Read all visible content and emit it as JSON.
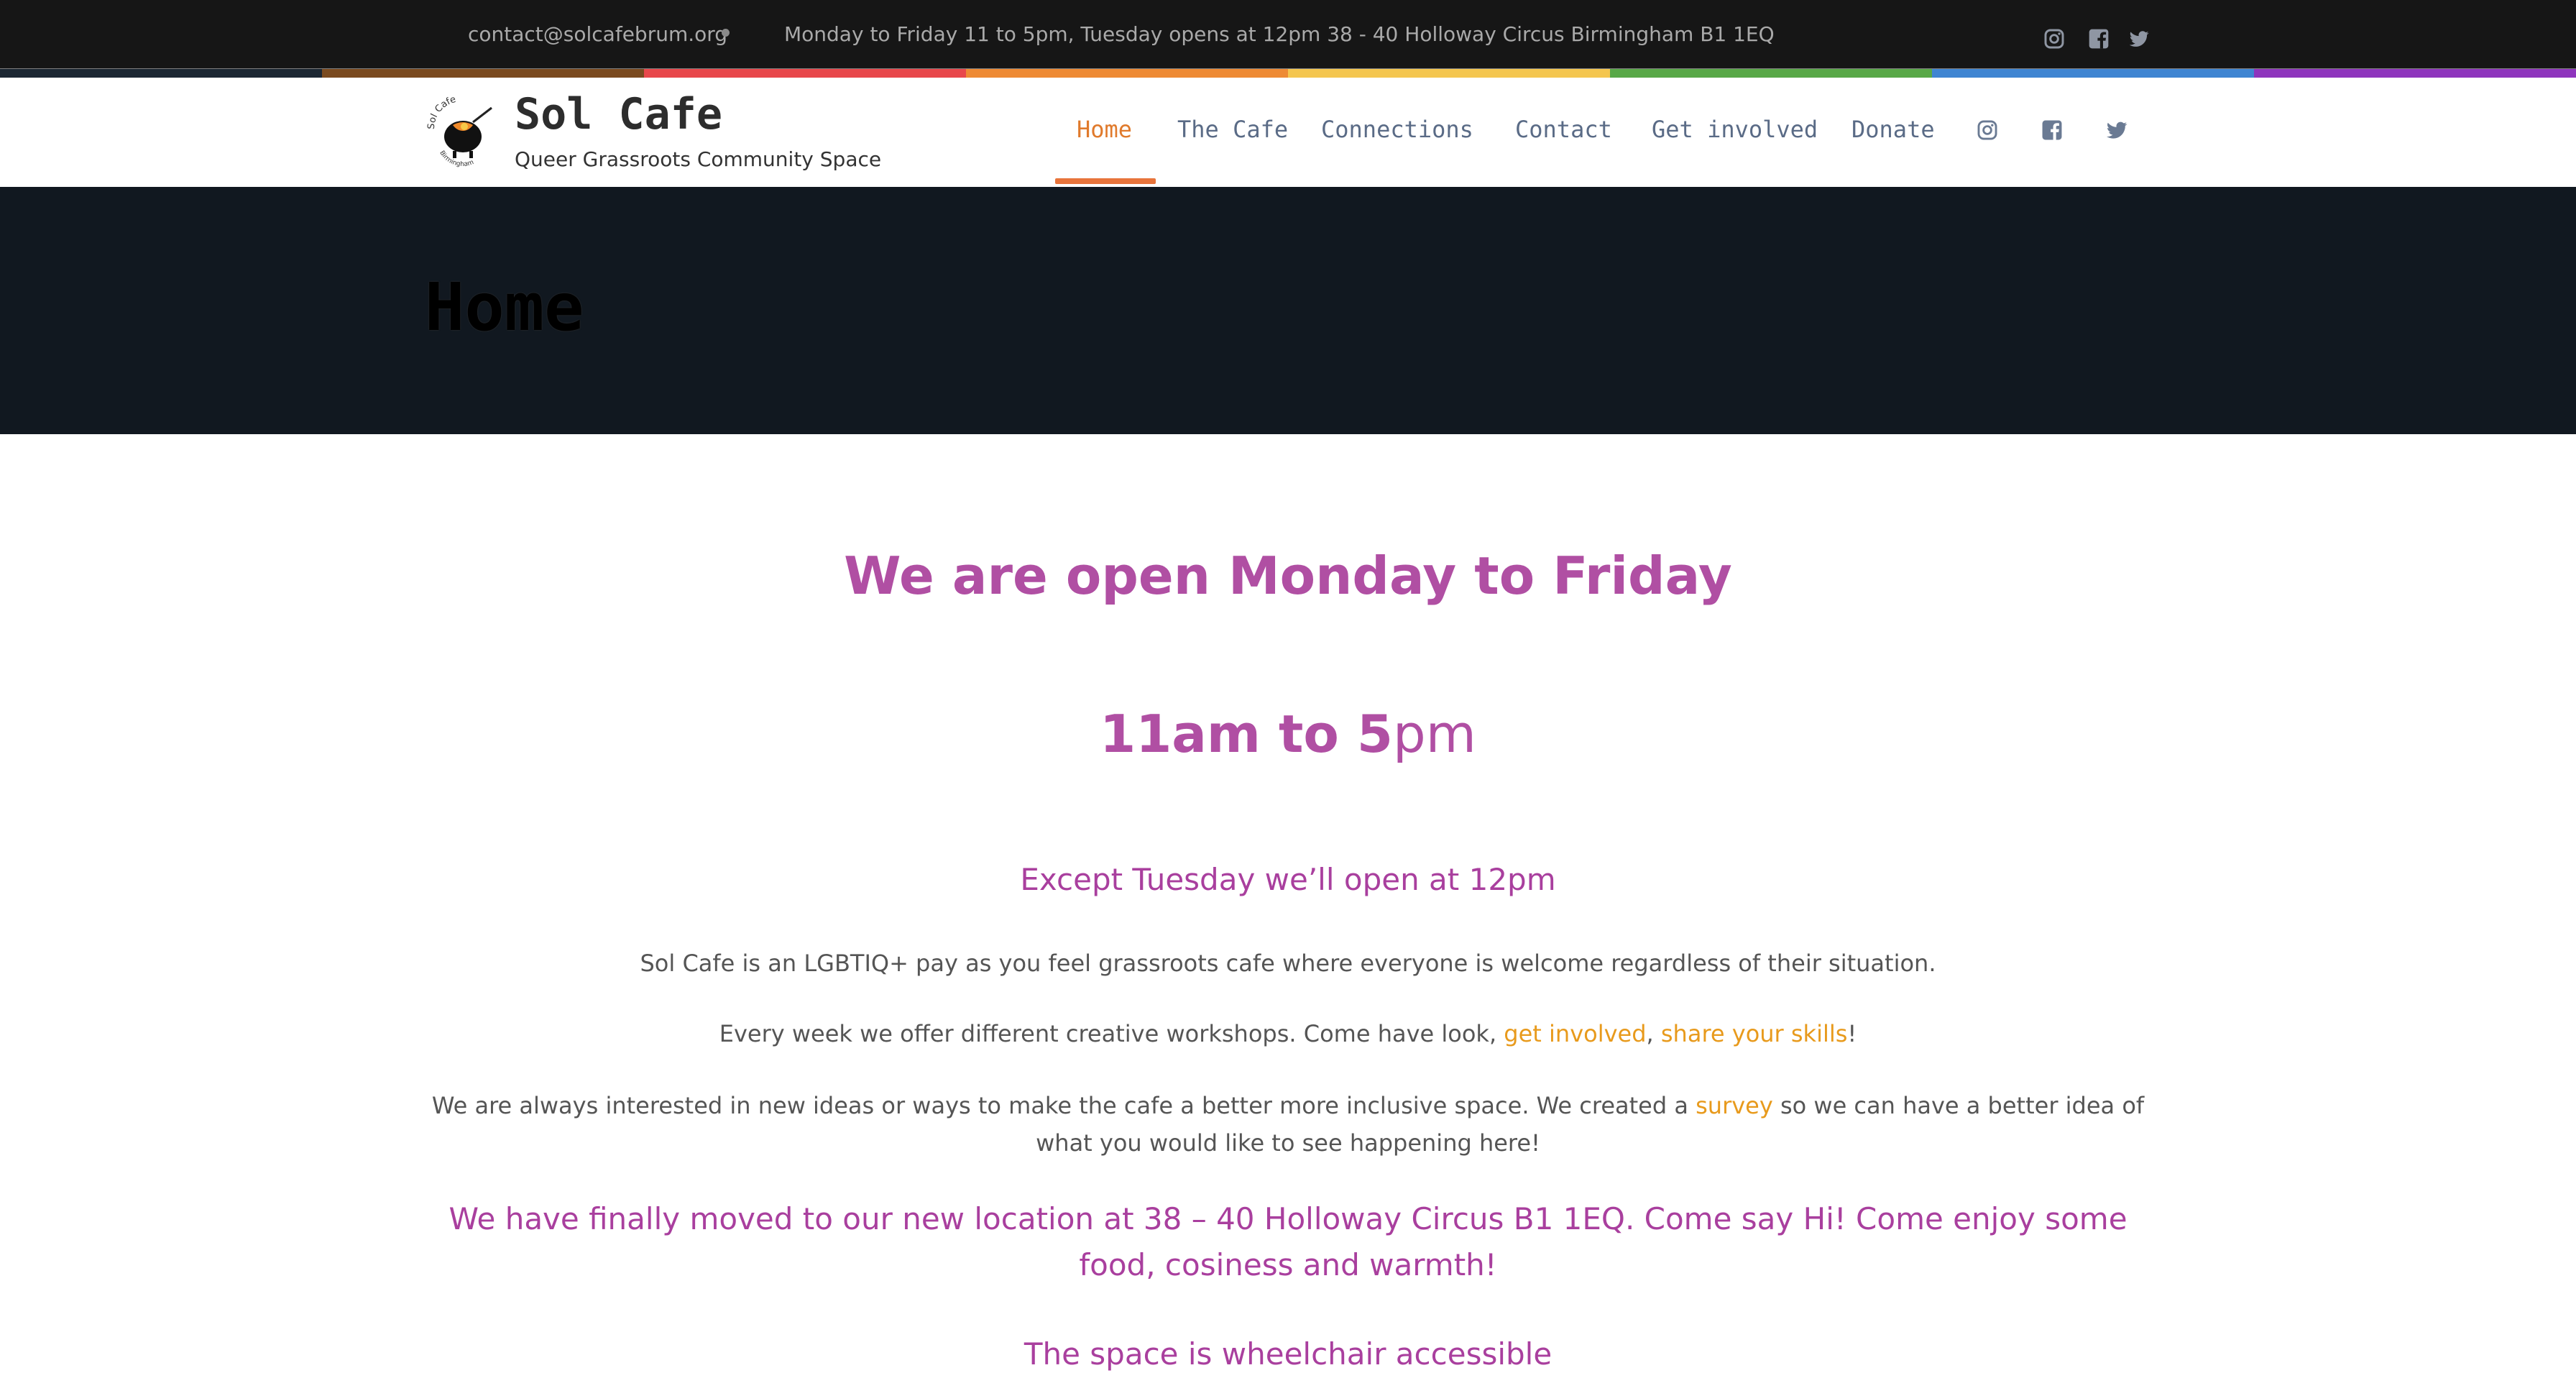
{
  "topbar": {
    "email": "contact@solcafebrum.org",
    "hours_address": "Monday to Friday 11 to 5pm, Tuesday opens at 12pm 38 - 40 Holloway Circus Birmingham B1 1EQ",
    "social_icons": [
      "instagram-icon",
      "facebook-icon",
      "twitter-icon"
    ]
  },
  "rainbow_colors": [
    "#1c2733",
    "#7a4a1f",
    "#e8474b",
    "#ee8a34",
    "#f4c64f",
    "#58a847",
    "#3f85d2",
    "#8e35bd"
  ],
  "header": {
    "title": "Sol Cafe",
    "subtitle": "Queer Grassroots Community Space",
    "logo_text": "Sol Cafe Birmingham",
    "nav": [
      {
        "label": "Home",
        "active": true
      },
      {
        "label": "The Cafe"
      },
      {
        "label": "Connections"
      },
      {
        "label": "Contact"
      },
      {
        "label": "Get involved"
      },
      {
        "label": "Donate"
      }
    ],
    "nav_icons": [
      "instagram-icon",
      "facebook-icon",
      "twitter-icon"
    ]
  },
  "hero": {
    "title": "Home"
  },
  "main": {
    "open_heading": "We are open Monday to Friday",
    "hours_bold": "11am to 5",
    "hours_rest": "pm",
    "except_text": "Except Tuesday we’ll open at 12pm",
    "intro": "Sol Cafe is an LGBTIQ+ pay as you feel grassroots cafe where everyone is welcome regardless of their situation.",
    "workshops_prefix": "Every week we offer different creative workshops. Come have look, ",
    "link_get_involved": "get involved",
    "workshops_sep": ", ",
    "link_share_skills": "share your skills",
    "workshops_suffix": "!",
    "ideas_prefix": "We are always interested in new ideas or ways to make the cafe a better more inclusive space. We created a ",
    "link_survey": "survey",
    "ideas_suffix": " so we can have a better idea of what you would like to see happening here!",
    "moved_text": "We have finally moved to our new location at 38 – 40 Holloway Circus B1 1EQ. Come say Hi! Come enjoy some food, cosiness and warmth!",
    "accessible_text": "The space is wheelchair accessible"
  },
  "colors": {
    "accent_orange": "#e07a2c",
    "heading_purple": "#b04fa3",
    "link_orange": "#e89a1c",
    "hero_bg": "#111820",
    "topbar_bg": "#161616"
  }
}
